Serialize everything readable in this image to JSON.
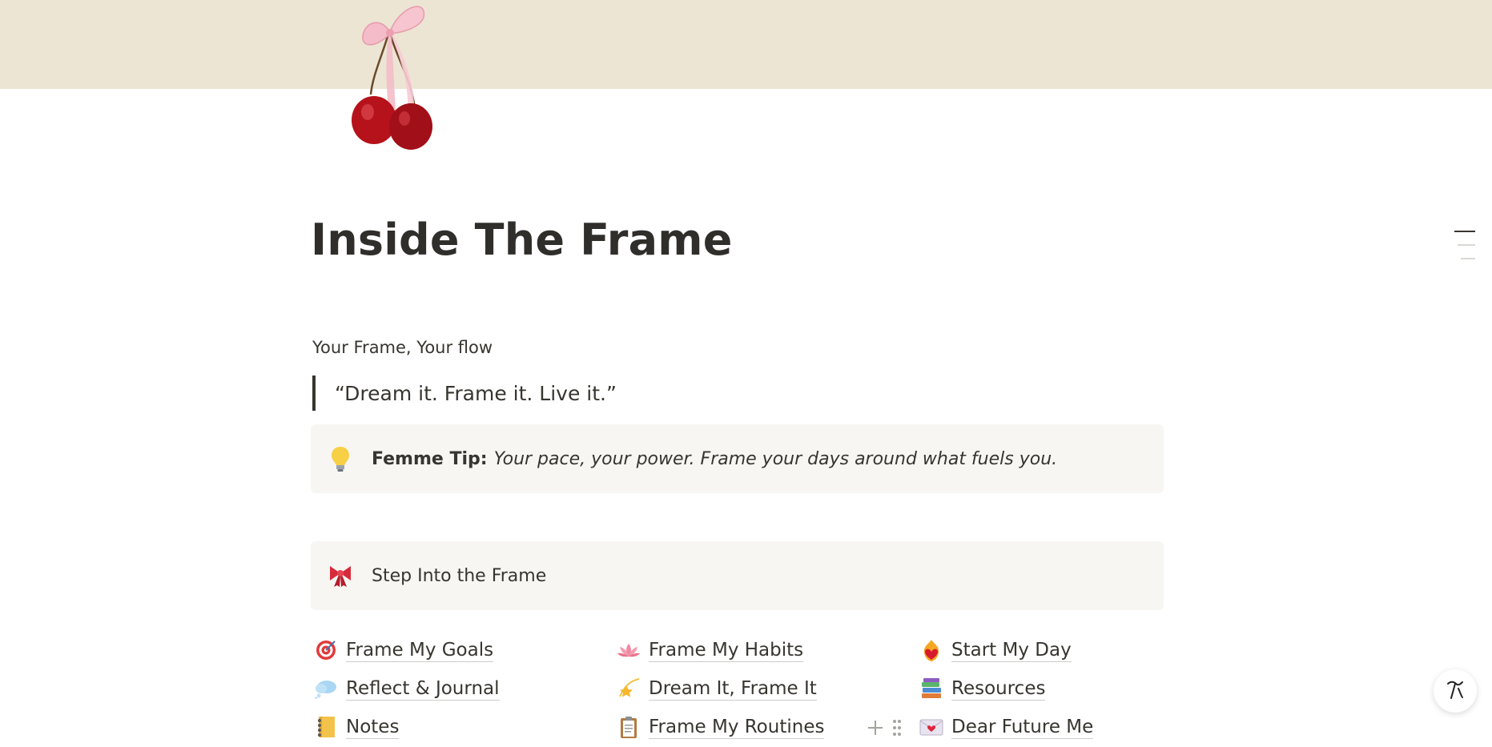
{
  "page": {
    "title": "Inside The Frame",
    "subtitle": "Your Frame, Your flow",
    "quote": "“Dream it. Frame it. Live it.”",
    "colors": {
      "cover": "#ece5d4",
      "text": "#37352f",
      "callout_bg": "#f7f6f3"
    }
  },
  "page_icon": "cherry-with-bow-icon",
  "tip_callout": {
    "icon": "lightbulb-icon",
    "label": "Femme Tip:",
    "body": "Your pace, your power. Frame your days around what fuels you."
  },
  "step_callout": {
    "icon": "ribbon-bow-icon",
    "label": "Step Into the Frame"
  },
  "links": [
    {
      "label": "Frame My Goals",
      "icon": "target-icon"
    },
    {
      "label": "Reflect & Journal",
      "icon": "thought-cloud-icon"
    },
    {
      "label": "Notes",
      "icon": "notebook-icon"
    },
    {
      "label": "Frame My Habits",
      "icon": "lotus-icon"
    },
    {
      "label": "Dream It, Frame It",
      "icon": "shooting-star-icon"
    },
    {
      "label": "Frame My Routines",
      "icon": "clipboard-icon"
    },
    {
      "label": "Start My Day",
      "icon": "flaming-heart-icon"
    },
    {
      "label": "Resources",
      "icon": "books-icon"
    },
    {
      "label": "Dear Future Me",
      "icon": "love-letter-icon"
    }
  ]
}
